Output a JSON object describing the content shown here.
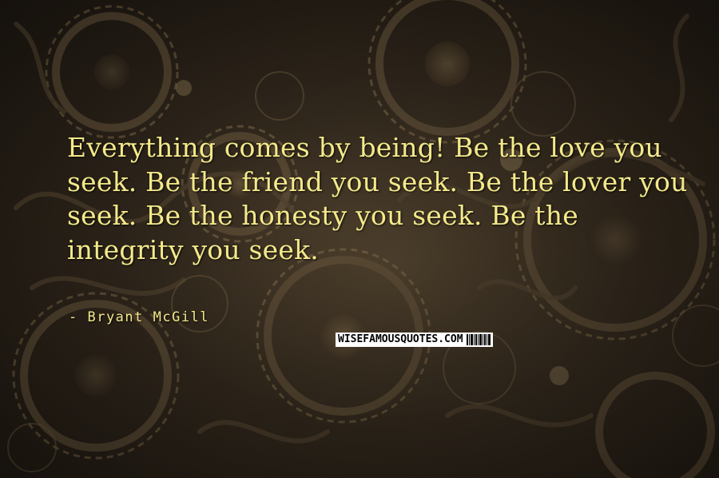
{
  "quote": {
    "text": "Everything comes by being! Be the love you seek. Be the friend you seek. Be the lover you seek. Be the honesty you seek. Be the integrity you seek.",
    "author": "- Bryant McGill"
  },
  "watermark": {
    "text": "WISEFAMOUSQUOTES.COM"
  },
  "colors": {
    "text": "#f4e98a",
    "background": "#3a2f22"
  },
  "background_image": "clockwork-gears-image"
}
